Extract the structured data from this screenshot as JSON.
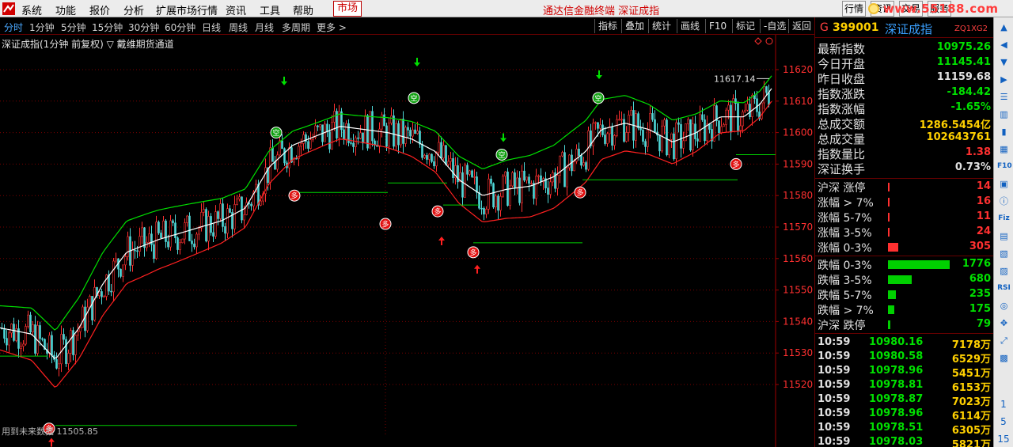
{
  "menubar": {
    "items": [
      "系统",
      "功能",
      "报价",
      "分析",
      "扩展市场行情",
      "资讯",
      "工具",
      "帮助"
    ],
    "market_tab": "市场",
    "center_title": "通达信金融终端  深证成指",
    "right_buttons": [
      "行情",
      "资讯",
      "交易",
      "服务"
    ],
    "watermark": "www.55188.com"
  },
  "periodbar": {
    "periods": [
      "分时",
      "1分钟",
      "5分钟",
      "15分钟",
      "30分钟",
      "60分钟",
      "日线",
      "周线",
      "月线",
      "多周期",
      "更多 >"
    ],
    "active": "分时",
    "tools": [
      "指标",
      "叠加",
      "统计",
      "画线",
      "F10",
      "标记",
      "-自选",
      "返回"
    ]
  },
  "chart": {
    "title": "深证成指(1分钟 前复权) ▽ 戴维期货通道",
    "low_label": "用到未来数据 11505.85",
    "high_label": "11617.14",
    "buy_glyph": "多",
    "sell_glyph": "空",
    "price_labels": [
      "11620",
      "11610",
      "11600",
      "11590",
      "11580",
      "11570",
      "11560",
      "11550",
      "11540",
      "11530",
      "11520"
    ],
    "colors": {
      "up": "#ff3030",
      "down": "#4fd7d7",
      "mid": "#ffffff",
      "upper_band": "#00e000",
      "lower_band": "#ff2020",
      "grid": "#7a0000"
    }
  },
  "panel": {
    "g": "G",
    "code": "399001",
    "name": "深证成指",
    "tag": "ZQ1XG2",
    "stats": [
      {
        "label": "最新指数",
        "value": "10975.26",
        "color": "#00e000"
      },
      {
        "label": "今日开盘",
        "value": "11145.41",
        "color": "#00e000"
      },
      {
        "label": "昨日收盘",
        "value": "11159.68",
        "color": "#e0e0e0"
      },
      {
        "label": "指数涨跌",
        "value": "-184.42",
        "color": "#00e000"
      },
      {
        "label": "指数涨幅",
        "value": "-1.65%",
        "color": "#00e000"
      },
      {
        "label": "总成交额",
        "value": "1286.5454亿",
        "color": "#ffd000"
      },
      {
        "label": "总成交量",
        "value": "102643761",
        "color": "#ffd000"
      },
      {
        "label": "指数量比",
        "value": "1.38",
        "color": "#ff3030"
      },
      {
        "label": "深证换手",
        "value": "0.73%",
        "color": "#e0e0e0"
      }
    ],
    "rise": [
      {
        "label": "沪深 涨停",
        "value": "14",
        "ratio": 0.008
      },
      {
        "label": "涨幅 > 7%",
        "value": "16",
        "ratio": 0.009
      },
      {
        "label": "涨幅 5-7%",
        "value": "11",
        "ratio": 0.006
      },
      {
        "label": "涨幅 3-5%",
        "value": "24",
        "ratio": 0.014
      },
      {
        "label": "涨幅 0-3%",
        "value": "305",
        "ratio": 0.172
      }
    ],
    "fall": [
      {
        "label": "跌幅 0-3%",
        "value": "1776",
        "ratio": 1.0
      },
      {
        "label": "跌幅 3-5%",
        "value": "680",
        "ratio": 0.383
      },
      {
        "label": "跌幅 5-7%",
        "value": "235",
        "ratio": 0.132
      },
      {
        "label": "跌幅 > 7%",
        "value": "175",
        "ratio": 0.099
      },
      {
        "label": "沪深 跌停",
        "value": "79",
        "ratio": 0.044
      }
    ],
    "ticks": [
      {
        "time": "10:59",
        "price": "10980.16",
        "vol": "7178万"
      },
      {
        "time": "10:59",
        "price": "10980.58",
        "vol": "6529万"
      },
      {
        "time": "10:59",
        "price": "10978.96",
        "vol": "5451万"
      },
      {
        "time": "10:59",
        "price": "10978.81",
        "vol": "6153万"
      },
      {
        "time": "10:59",
        "price": "10978.87",
        "vol": "7023万"
      },
      {
        "time": "10:59",
        "price": "10978.96",
        "vol": "6114万"
      },
      {
        "time": "10:59",
        "price": "10978.51",
        "vol": "6305万"
      },
      {
        "time": "10:59",
        "price": "10978.03",
        "vol": "5821万"
      }
    ]
  },
  "side": {
    "icons": [
      "up-arrow-icon",
      "left-arrow-icon",
      "down-arrow-icon",
      "right-arrow-icon",
      "list-icon",
      "chart-bar-icon",
      "kline-icon",
      "grid-icon",
      "f10-icon",
      "fund-icon",
      "info-icon",
      "fiz-icon",
      "finance-icon",
      "vol-icon",
      "macd-icon",
      "rsi-icon",
      "target-icon",
      "move-icon",
      "expand-icon",
      "table-icon"
    ],
    "icon_labels": [
      "",
      "",
      "",
      "",
      "",
      "",
      "",
      "",
      "F10",
      "",
      "",
      "Fiz",
      "",
      "",
      "",
      "RSI",
      "",
      "",
      "",
      ""
    ],
    "numbers": [
      "1",
      "5",
      "15"
    ]
  }
}
